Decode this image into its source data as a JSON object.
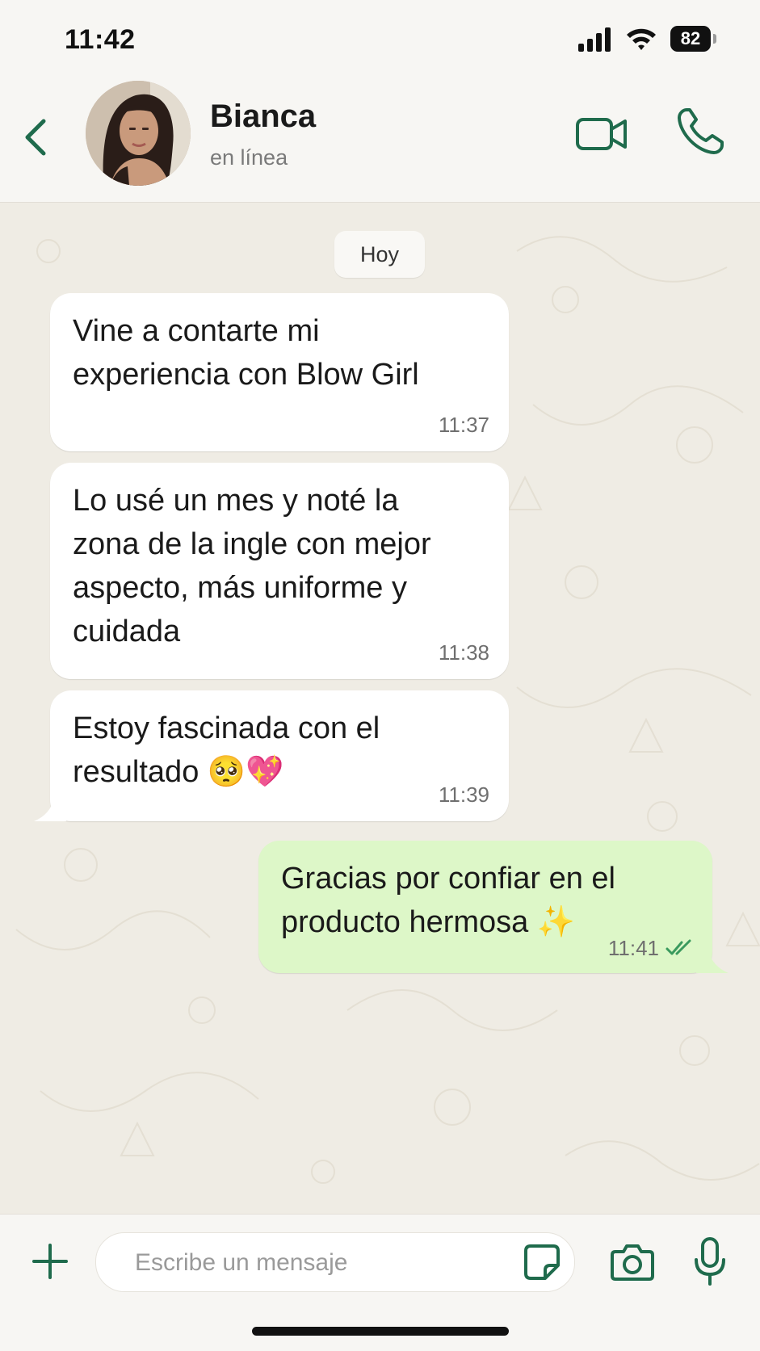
{
  "status_bar": {
    "time": "11:42",
    "battery": "82"
  },
  "header": {
    "contact_name": "Bianca",
    "contact_status": "en línea"
  },
  "chat": {
    "day_label": "Hoy",
    "messages": [
      {
        "direction": "incoming",
        "text": "Vine a contarte mi\nexperiencia con Blow Girl",
        "time": "11:37"
      },
      {
        "direction": "incoming",
        "text": "Lo usé un mes y noté la\nzona de la ingle con mejor\naspecto, más uniforme y\ncuidada",
        "time": "11:38"
      },
      {
        "direction": "incoming",
        "text": "Estoy fascinada con el\nresultado 🥺💖",
        "time": "11:39"
      },
      {
        "direction": "outgoing",
        "text": "Gracias por confiar en el\nproducto hermosa ✨",
        "time": "11:41",
        "read": true
      }
    ]
  },
  "composer": {
    "placeholder": "Escribe un mensaje"
  },
  "colors": {
    "accent": "#1f6b4c",
    "outgoing_bubble": "#ddf7c8",
    "incoming_bubble": "#ffffff",
    "read_tick": "#3a9a5e"
  },
  "icons": [
    "back-chevron-icon",
    "video-call-icon",
    "phone-icon",
    "plus-icon",
    "sticker-icon",
    "camera-icon",
    "microphone-icon",
    "double-check-icon"
  ]
}
